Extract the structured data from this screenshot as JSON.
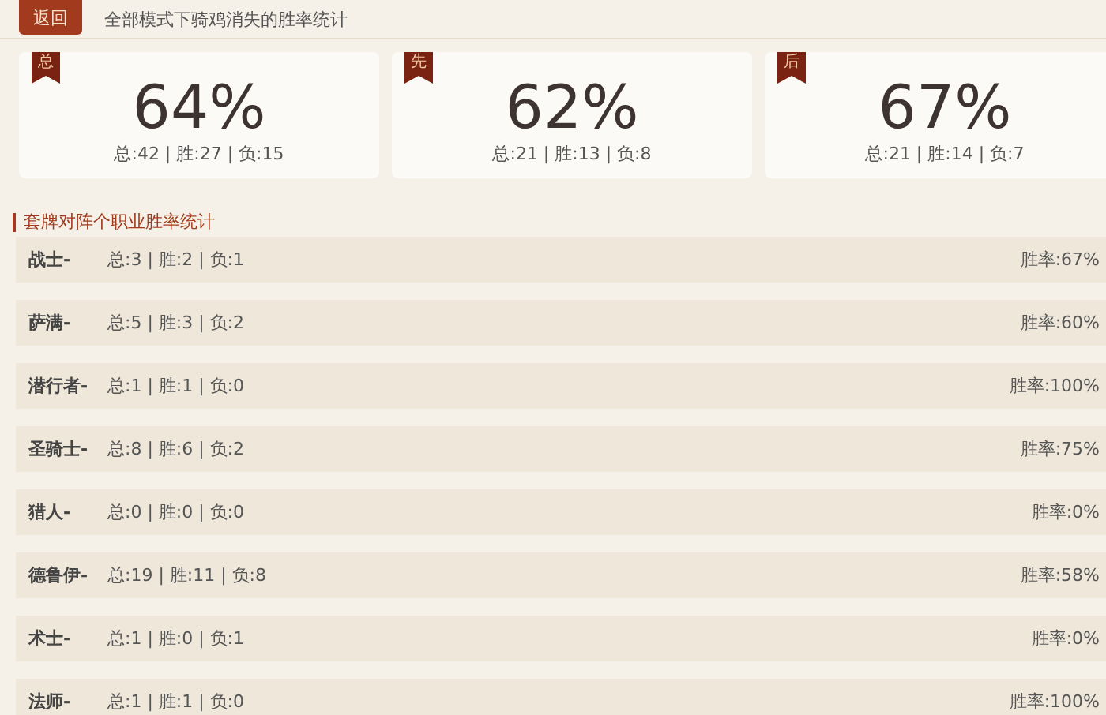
{
  "header": {
    "back_button": "返回",
    "title": "全部模式下骑鸡消失的胜率统计"
  },
  "summary_cards": [
    {
      "badge": "总",
      "percent": "64%",
      "stats": "总:42 | 胜:27 | 负:15"
    },
    {
      "badge": "先",
      "percent": "62%",
      "stats": "总:21 | 胜:13 | 负:8"
    },
    {
      "badge": "后",
      "percent": "67%",
      "stats": "总:21 | 胜:14 | 负:7"
    }
  ],
  "section_title": "套牌对阵个职业胜率统计",
  "class_rows": [
    {
      "name": "战士-",
      "stats": "总:3 | 胜:2 | 负:1",
      "rate": "胜率:67%"
    },
    {
      "name": "萨满-",
      "stats": "总:5 | 胜:3 | 负:2",
      "rate": "胜率:60%"
    },
    {
      "name": "潜行者-",
      "stats": "总:1 | 胜:1 | 负:0",
      "rate": "胜率:100%"
    },
    {
      "name": "圣骑士-",
      "stats": "总:8 | 胜:6 | 负:2",
      "rate": "胜率:75%"
    },
    {
      "name": "猎人-",
      "stats": "总:0 | 胜:0 | 负:0",
      "rate": "胜率:0%"
    },
    {
      "name": "德鲁伊-",
      "stats": "总:19 | 胜:11 | 负:8",
      "rate": "胜率:58%"
    },
    {
      "name": "术士-",
      "stats": "总:1 | 胜:0 | 负:1",
      "rate": "胜率:0%"
    },
    {
      "name": "法师-",
      "stats": "总:1 | 胜:1 | 负:0",
      "rate": "胜率:100%"
    }
  ]
}
